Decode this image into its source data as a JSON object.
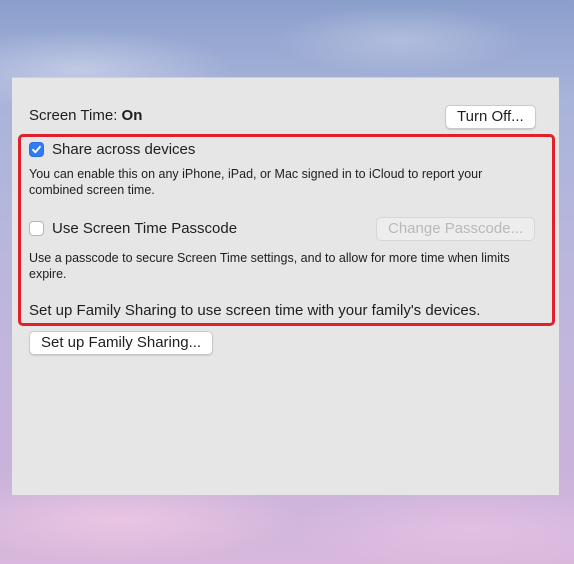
{
  "screen_time": {
    "label": "Screen Time:",
    "status": "On",
    "turn_off_label": "Turn Off..."
  },
  "share_devices": {
    "label": "Share across devices",
    "checked": true,
    "description": "You can enable this on any iPhone, iPad, or Mac signed in to iCloud to report your combined screen time."
  },
  "passcode": {
    "label": "Use Screen Time Passcode",
    "checked": false,
    "change_label": "Change Passcode...",
    "description": "Use a passcode to secure Screen Time settings, and to allow for more time when limits expire."
  },
  "family": {
    "note": "Set up Family Sharing to use screen time with your family's devices.",
    "button_label": "Set up Family Sharing..."
  },
  "colors": {
    "accent": "#2f7cf6",
    "highlight": "#e0202b"
  }
}
